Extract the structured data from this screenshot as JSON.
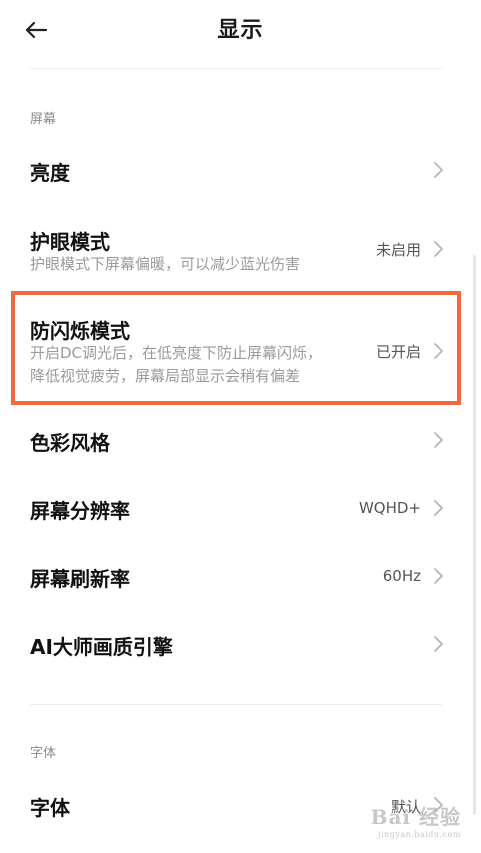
{
  "header": {
    "title": "显示"
  },
  "sections": {
    "screen_label": "屏幕",
    "font_label": "字体"
  },
  "rows": {
    "brightness": {
      "label": "亮度"
    },
    "eye_care": {
      "label": "护眼模式",
      "desc": "护眼模式下屏幕偏暖，可以减少蓝光伤害",
      "value": "未启用"
    },
    "anti_flicker": {
      "label": "防闪烁模式",
      "desc_line1": "开启DC调光后，在低亮度下防止屏幕闪烁，",
      "desc_line2": "降低视觉疲劳，屏幕局部显示会稍有偏差",
      "value": "已开启"
    },
    "color_style": {
      "label": "色彩风格"
    },
    "resolution": {
      "label": "屏幕分辨率",
      "value": "WQHD+"
    },
    "refresh_rate": {
      "label": "屏幕刷新率",
      "value": "60Hz"
    },
    "ai_engine": {
      "label": "AI大师画质引擎"
    },
    "font": {
      "label": "字体",
      "value": "默认"
    }
  },
  "icons": {
    "back": "back-arrow-icon",
    "chevron": "chevron-right-icon"
  },
  "colors": {
    "highlight_border": "#f26a3b",
    "section_label": "#8a8a8a",
    "desc_text": "#9a9a9a"
  },
  "watermark": {
    "main": "Bai 经验",
    "sub": "jingyan.baidu.com"
  }
}
